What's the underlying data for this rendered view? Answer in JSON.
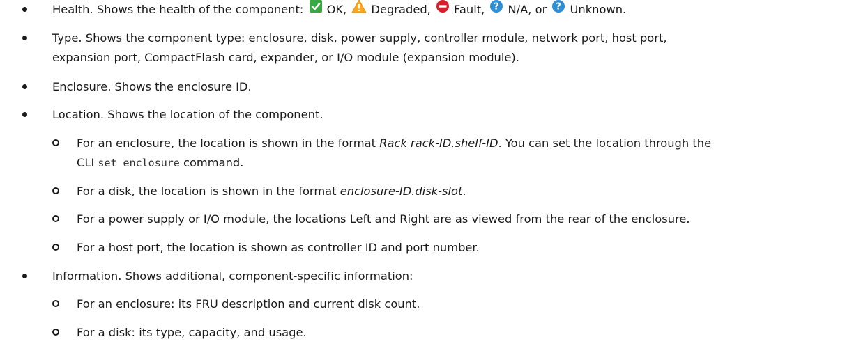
{
  "health": {
    "intro": "Health. Shows the health of the component:",
    "ok": "OK,",
    "degraded": "Degraded,",
    "fault": "Fault,",
    "na": "N/A, or",
    "unknown": "Unknown."
  },
  "type": {
    "line1": "Type. Shows the component type: enclosure, disk, power supply, controller module, network port, host port,",
    "line2": "expansion port, CompactFlash card, expander, or I/O module (expansion module)."
  },
  "enclosure": {
    "text": "Enclosure. Shows the enclosure ID."
  },
  "location": {
    "text": "Location. Shows the location of the component.",
    "sub1": {
      "pre": "For an enclosure, the location is shown in the format ",
      "em": "Rack rack-ID.shelf-ID",
      "post": ". You can set the location through the",
      "l2_pre": "CLI ",
      "code": "set enclosure",
      "l2_post": " command."
    },
    "sub2": {
      "pre": "For a disk, the location is shown in the format ",
      "em": "enclosure-ID.disk-slot",
      "post": "."
    },
    "sub3": "For a power supply or I/O module, the locations Left and Right are as viewed from the rear of the enclosure.",
    "sub4": "For a host port, the location is shown as controller ID and port number."
  },
  "information": {
    "text": "Information. Shows additional, component-specific information:",
    "sub1": "For an enclosure: its FRU description and current disk count.",
    "sub2": "For a disk: its type, capacity, and usage."
  },
  "icons": [
    "check-ok-icon",
    "warning-degraded-icon",
    "fault-icon",
    "help-na-icon",
    "help-unknown-icon"
  ],
  "colors": {
    "ok": "#3aa845",
    "degraded": "#f5a623",
    "fault": "#d71f2c",
    "info": "#2d8fd5"
  }
}
